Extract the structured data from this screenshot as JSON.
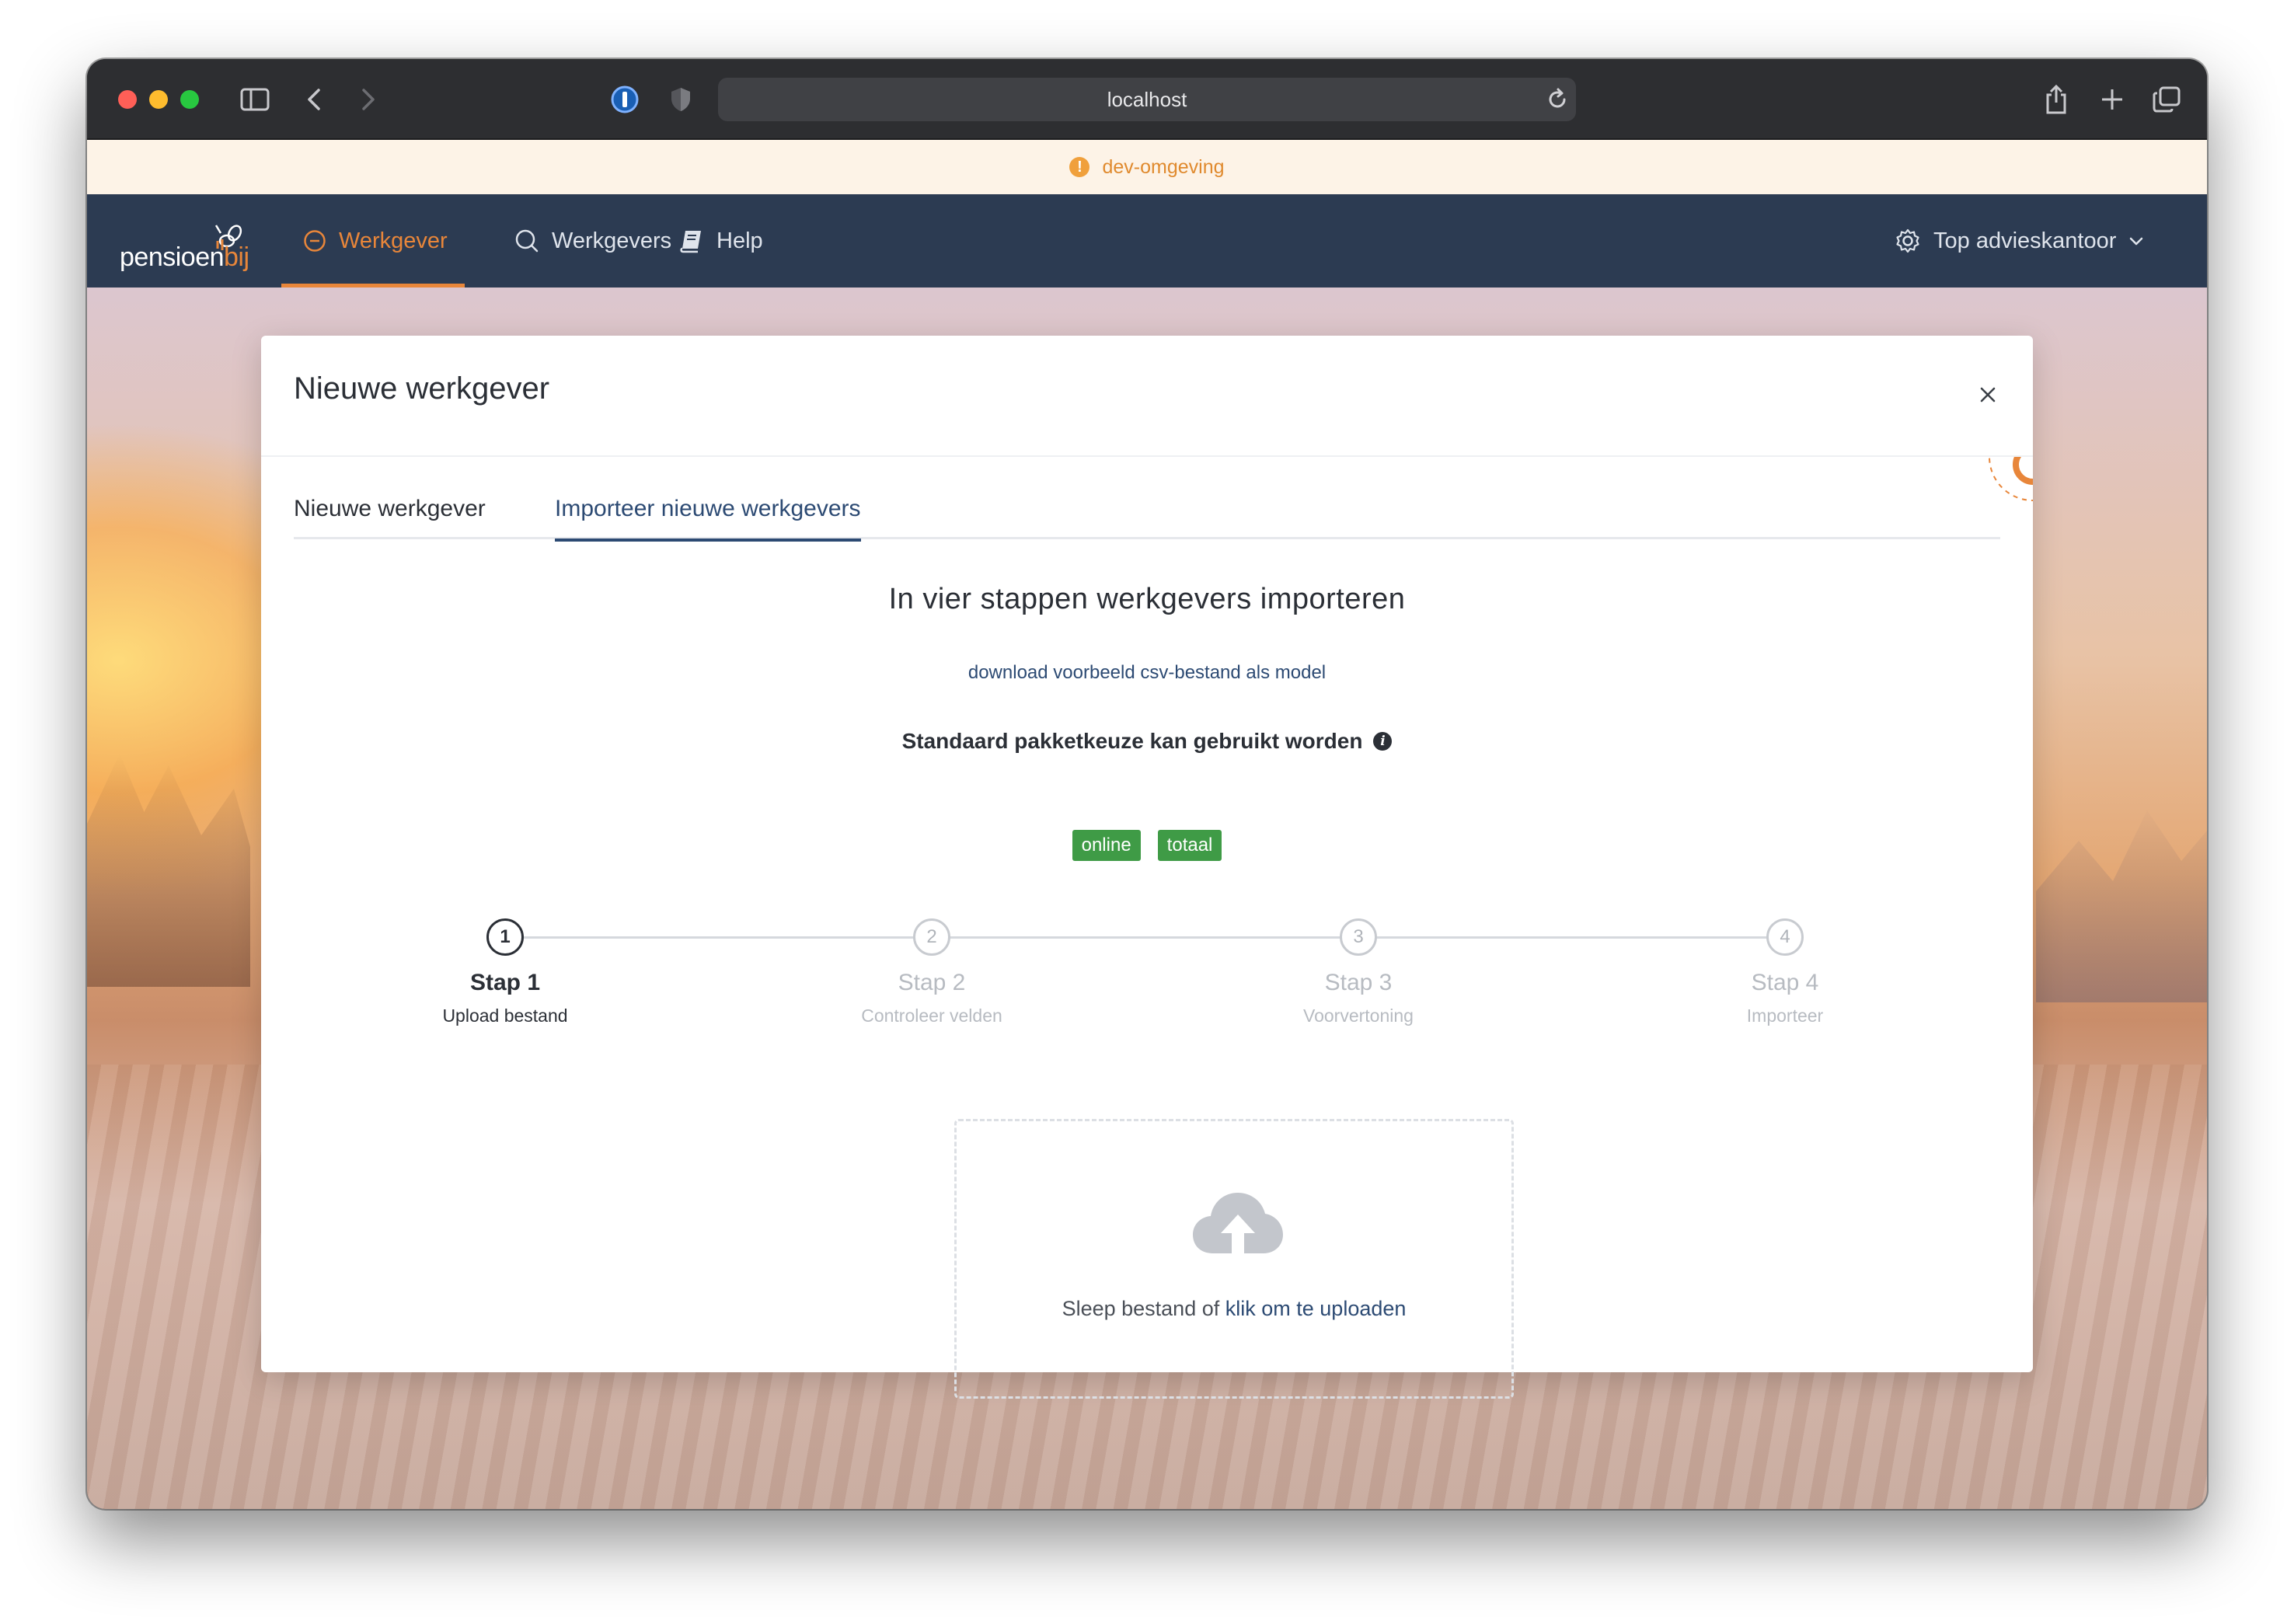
{
  "browser": {
    "url": "localhost"
  },
  "dev_banner": {
    "text": "dev-omgeving"
  },
  "nav": {
    "logo_main": "pensioen",
    "logo_accent": "bij",
    "items": [
      {
        "label": "Werkgever",
        "active": true
      },
      {
        "label": "Werkgevers",
        "active": false
      },
      {
        "label": "Help",
        "active": false
      }
    ],
    "account": "Top advieskantoor"
  },
  "modal": {
    "title": "Nieuwe werkgever",
    "tabs": [
      {
        "label": "Nieuwe werkgever",
        "active": false
      },
      {
        "label": "Importeer nieuwe werkgevers",
        "active": true
      }
    ],
    "headline": "In vier stappen werkgevers importeren",
    "download_link": "download voorbeeld csv-bestand als model",
    "standard_label": "Standaard pakketkeuze kan gebruikt worden",
    "badges": [
      "online",
      "totaal"
    ],
    "steps": [
      {
        "number": "1",
        "title": "Stap 1",
        "subtitle": "Upload bestand",
        "done": true
      },
      {
        "number": "2",
        "title": "Stap 2",
        "subtitle": "Controleer velden",
        "done": false
      },
      {
        "number": "3",
        "title": "Stap 3",
        "subtitle": "Voorvertoning",
        "done": false
      },
      {
        "number": "4",
        "title": "Stap 4",
        "subtitle": "Importeer",
        "done": false
      }
    ],
    "upload": {
      "text": "Sleep bestand of",
      "link": "klik om te uploaden"
    }
  },
  "colors": {
    "nav_bg": "#2c3b52",
    "accent": "#e8863a",
    "link": "#2c4a73",
    "badge": "#3f9b46"
  }
}
